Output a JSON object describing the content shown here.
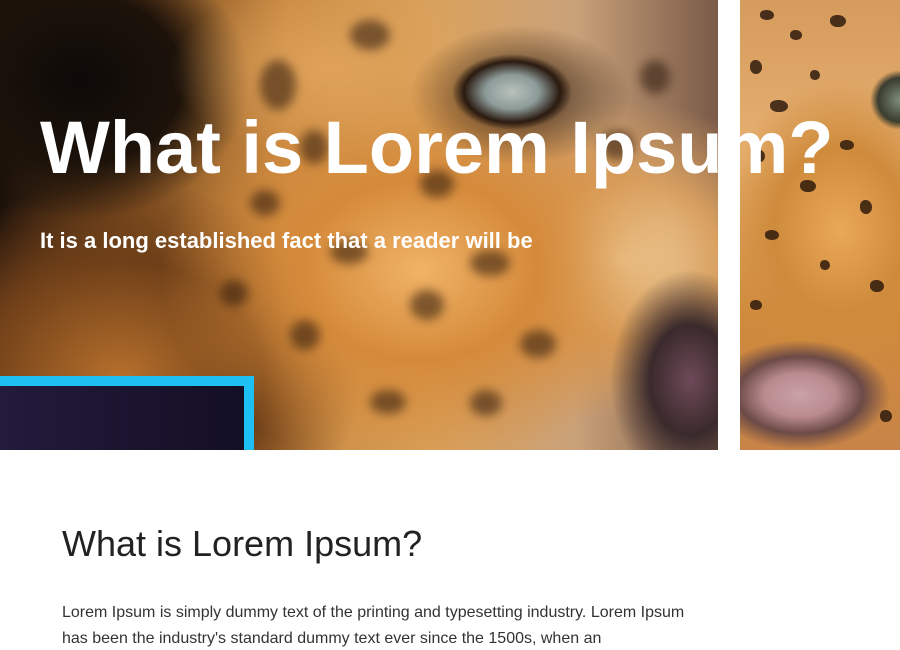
{
  "hero": {
    "title": "What is Lorem Ipsum?",
    "subtitle": "It is a long established fact that a reader will be",
    "accent_color": "#1cc0f2",
    "image": "leopard-face"
  },
  "content": {
    "heading": "What is Lorem Ipsum?",
    "body": "Lorem Ipsum is simply dummy text of the printing and typesetting industry. Lorem Ipsum has been the industry's standard dummy text ever since the 1500s, when an"
  }
}
